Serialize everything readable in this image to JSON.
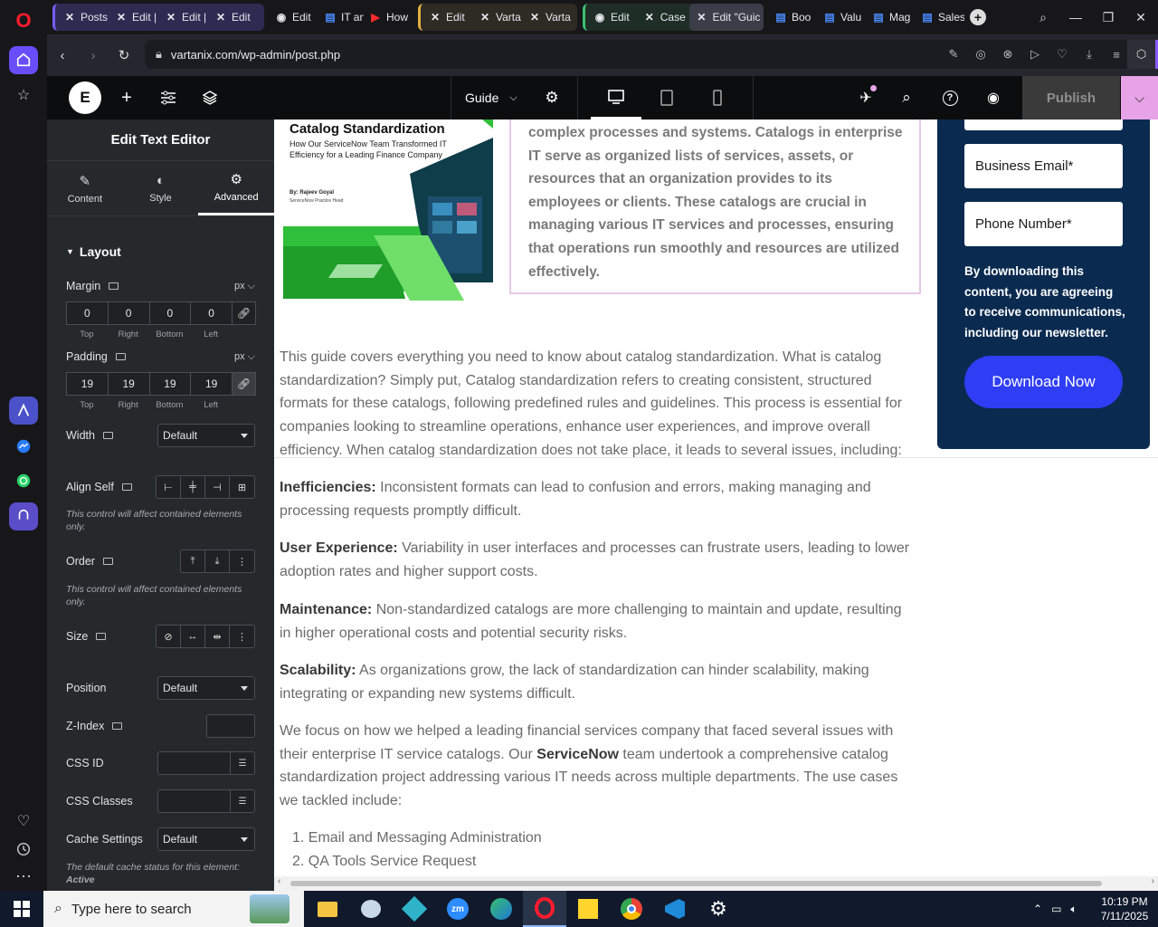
{
  "browser": {
    "tabs": [
      {
        "label": "Posts",
        "icon": "x-icon"
      },
      {
        "label": "Edit |",
        "icon": "x-icon"
      },
      {
        "label": "Edit |",
        "icon": "x-icon"
      },
      {
        "label": "Edit",
        "icon": "x-icon"
      },
      {
        "label": "Edit",
        "icon": "globe-icon"
      },
      {
        "label": "IT an",
        "icon": "doc-icon"
      },
      {
        "label": "How",
        "icon": "youtube-icon"
      },
      {
        "label": "Edit",
        "icon": "x-icon"
      },
      {
        "label": "Varta",
        "icon": "x-icon"
      },
      {
        "label": "Varta",
        "icon": "x-icon"
      },
      {
        "label": "Edit",
        "icon": "globe-icon"
      },
      {
        "label": "Case",
        "icon": "x-icon"
      },
      {
        "label": "Edit \"Guic",
        "icon": "x-icon"
      },
      {
        "label": "Boo",
        "icon": "doc-icon"
      },
      {
        "label": "Valu",
        "icon": "doc-icon"
      },
      {
        "label": "Mag",
        "icon": "doc-icon"
      },
      {
        "label": "Sales",
        "icon": "doc-icon"
      }
    ],
    "url": "vartanix.com/wp-admin/post.php"
  },
  "elementor": {
    "template_select": "Guide",
    "publish_label": "Publish"
  },
  "panel": {
    "title": "Edit Text Editor",
    "tabs": {
      "content": "Content",
      "style": "Style",
      "advanced": "Advanced"
    },
    "section": "Layout",
    "margin": {
      "label": "Margin",
      "unit": "px",
      "top": "0",
      "right": "0",
      "bottom": "0",
      "left": "0"
    },
    "padding": {
      "label": "Padding",
      "unit": "px",
      "top": "19",
      "right": "19",
      "bottom": "19",
      "left": "19"
    },
    "dim_labels": {
      "top": "Top",
      "right": "Right",
      "bottom": "Bottom",
      "left": "Left"
    },
    "width": {
      "label": "Width",
      "value": "Default"
    },
    "align_self": {
      "label": "Align Self",
      "note": "This control will affect contained elements only."
    },
    "order": {
      "label": "Order",
      "note": "This control will affect contained elements only."
    },
    "size": {
      "label": "Size"
    },
    "position": {
      "label": "Position",
      "value": "Default"
    },
    "zindex": {
      "label": "Z-Index"
    },
    "css_id": {
      "label": "CSS ID"
    },
    "css_classes": {
      "label": "CSS Classes"
    },
    "cache": {
      "label": "Cache Settings",
      "value": "Default",
      "note": "The default cache status for this element:",
      "status": "Active"
    }
  },
  "page": {
    "cover": {
      "title": "Catalog Standardization",
      "subtitle": "How Our ServiceNow Team Transformed IT Efficiency for a Leading Finance Company",
      "author": "By: Rajeev Goyal",
      "role": "ServiceNow Practice Head"
    },
    "boxed_text": "complex processes and systems. Catalogs in enterprise IT serve as organized lists of services, assets, or resources that an organization provides to its employees or clients. These catalogs are crucial in managing various IT services and processes, ensuring that operations run smoothly and resources are utilized effectively.",
    "intro": "This guide covers everything you need to know about catalog standardization. What is catalog standardization? Simply put, Catalog standardization refers to creating consistent, structured formats for these catalogs, following predefined rules and guidelines. This process is essential for companies looking to streamline operations, enhance user experiences, and improve overall efficiency. When catalog standardization does not take place, it leads to several issues, including:",
    "issues": [
      {
        "term": "Inefficiencies:",
        "text": " Inconsistent formats can lead to confusion and errors, making managing and processing requests promptly difficult."
      },
      {
        "term": "User Experience:",
        "text": " Variability in user interfaces and processes can frustrate users, leading to lower adoption rates and higher support costs."
      },
      {
        "term": "Maintenance:",
        "text": " Non-standardized catalogs are more challenging to maintain and update, resulting in higher operational costs and potential security risks."
      },
      {
        "term": "Scalability:",
        "text": " As organizations grow, the lack of standardization can hinder scalability, making integrating or expanding new systems difficult."
      }
    ],
    "focus_a": "We focus on how we helped a leading financial services company that faced several issues with their enterprise IT service catalogs. Our ",
    "focus_b": "ServiceNow",
    "focus_c": " team undertook a comprehensive catalog standardization project addressing various IT needs across multiple departments. The use cases we tackled include:",
    "list": [
      "Email and Messaging Administration",
      "QA Tools Service Request"
    ]
  },
  "form": {
    "email": "Business Email*",
    "phone": "Phone Number*",
    "consent": "By downloading this content, you are agreeing to receive communications, including our newsletter.",
    "button": "Download Now"
  },
  "taskbar": {
    "search_placeholder": "Type here to search",
    "time": "10:19 PM",
    "date": "7/11/2025"
  },
  "colors": {
    "accent": "#2f3ef5",
    "form_bg": "#0a2a50",
    "publish_bg": "#3a3a3a",
    "pink": "#e6a3e6"
  }
}
